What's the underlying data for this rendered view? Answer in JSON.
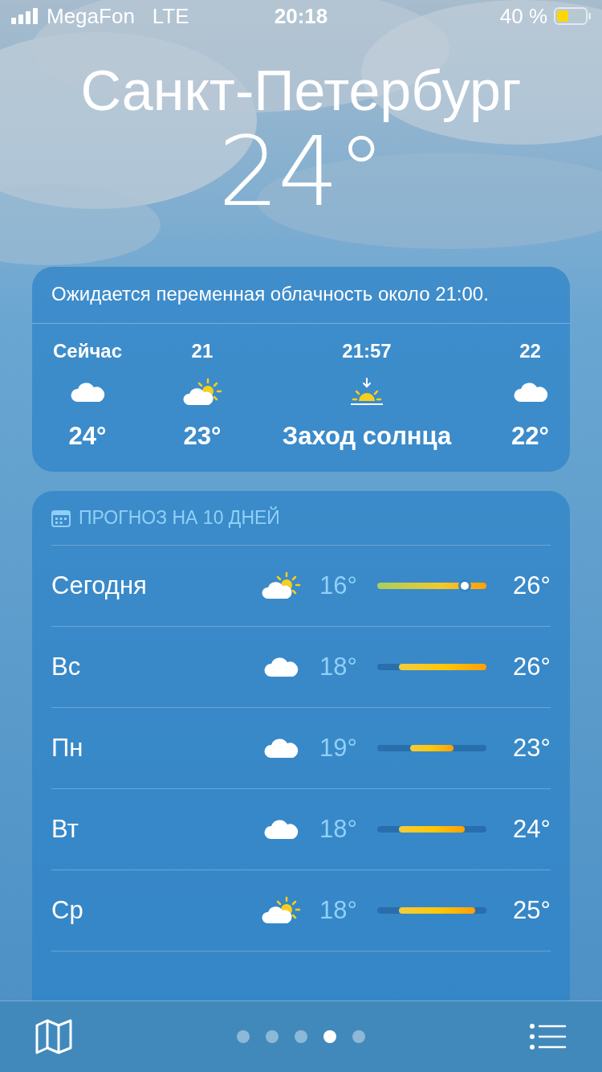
{
  "status_bar": {
    "carrier": "MegaFon",
    "network": "LTE",
    "time": "20:18",
    "battery": "40 %"
  },
  "header": {
    "city": "Санкт-Петербург",
    "temperature": "24°"
  },
  "hourly": {
    "summary": "Ожидается переменная облачность около 21:00.",
    "items": [
      {
        "time": "Сейчас",
        "kind": "cloud",
        "value": "24°"
      },
      {
        "time": "21",
        "kind": "partly_sunny",
        "value": "23°"
      },
      {
        "time": "21:57",
        "kind": "sunset",
        "value": "Заход солнца"
      },
      {
        "time": "22",
        "kind": "cloud",
        "value": "22°"
      }
    ]
  },
  "forecast": {
    "title": "ПРОГНОЗ НА 10 ДНЕЙ",
    "days": [
      {
        "day": "Сегодня",
        "kind": "partly_sunny",
        "low": "16°",
        "high": "26°",
        "now_marker": true,
        "level": 0.8
      },
      {
        "day": "Вс",
        "kind": "cloud",
        "low": "18°",
        "high": "26°",
        "now_marker": false
      },
      {
        "day": "Пн",
        "kind": "cloud",
        "low": "19°",
        "high": "23°",
        "now_marker": false
      },
      {
        "day": "Вт",
        "kind": "cloud",
        "low": "18°",
        "high": "24°",
        "now_marker": false
      },
      {
        "day": "Ср",
        "kind": "partly_sunny",
        "low": "18°",
        "high": "25°",
        "now_marker": false
      }
    ]
  },
  "pages": [
    {
      "selected": false
    },
    {
      "selected": false
    },
    {
      "selected": false
    },
    {
      "selected": true
    },
    {
      "selected": false
    }
  ]
}
